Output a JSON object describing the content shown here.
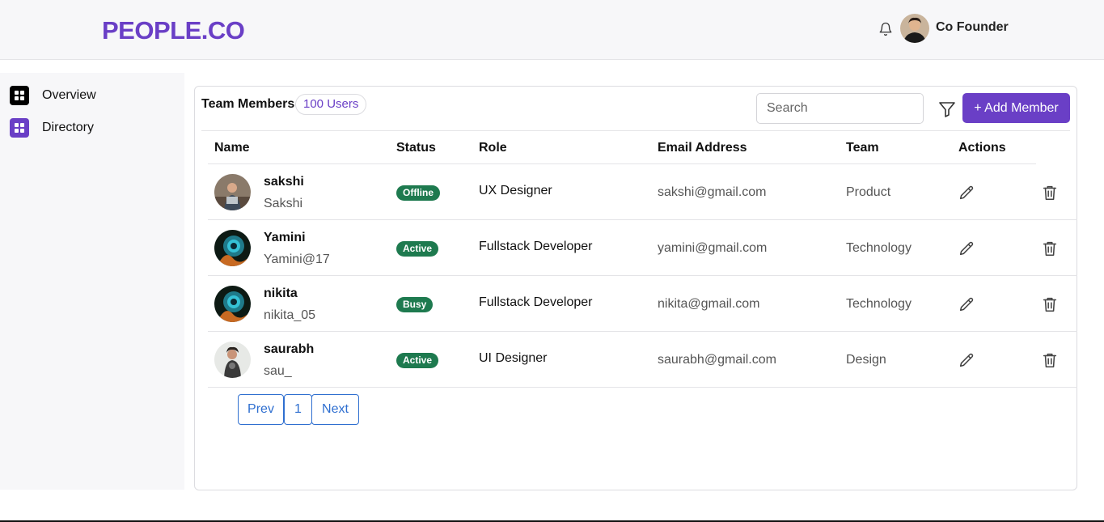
{
  "app": {
    "logo": "PEOPLE.CO"
  },
  "header": {
    "user_name": "Co Founder",
    "bell_icon": "bell-icon"
  },
  "sidebar": {
    "items": [
      {
        "label": "Overview",
        "icon": "grid-icon",
        "color": "#000000"
      },
      {
        "label": "Directory",
        "icon": "grid-icon",
        "color": "#6a3fc6"
      }
    ]
  },
  "team": {
    "title": "Team Members",
    "count": "100 Users",
    "search_placeholder": "Search",
    "add_button": "+ Add Member",
    "columns": [
      "Name",
      "Status",
      "Role",
      "Email Address",
      "Team",
      "Actions"
    ],
    "rows": [
      {
        "name": "sakshi",
        "username": "Sakshi",
        "status": "Offline",
        "role": "UX Designer",
        "email": "sakshi@gmail.com",
        "team": "Product"
      },
      {
        "name": "Yamini",
        "username": "Yamini@17",
        "status": "Active",
        "role": "Fullstack Developer",
        "email": "yamini@gmail.com",
        "team": "Technology"
      },
      {
        "name": "nikita",
        "username": "nikita_05",
        "status": "Busy",
        "role": "Fullstack Developer",
        "email": "nikita@gmail.com",
        "team": "Technology"
      },
      {
        "name": "saurabh",
        "username": "sau_",
        "status": "Active",
        "role": "UI Designer",
        "email": "saurabh@gmail.com",
        "team": "Design"
      }
    ]
  },
  "pagination": {
    "prev": "Prev",
    "page": "1",
    "next": "Next"
  },
  "colors": {
    "accent": "#6a3fc6",
    "status_badge": "#1e7a4f",
    "link": "#2f6fd0"
  }
}
